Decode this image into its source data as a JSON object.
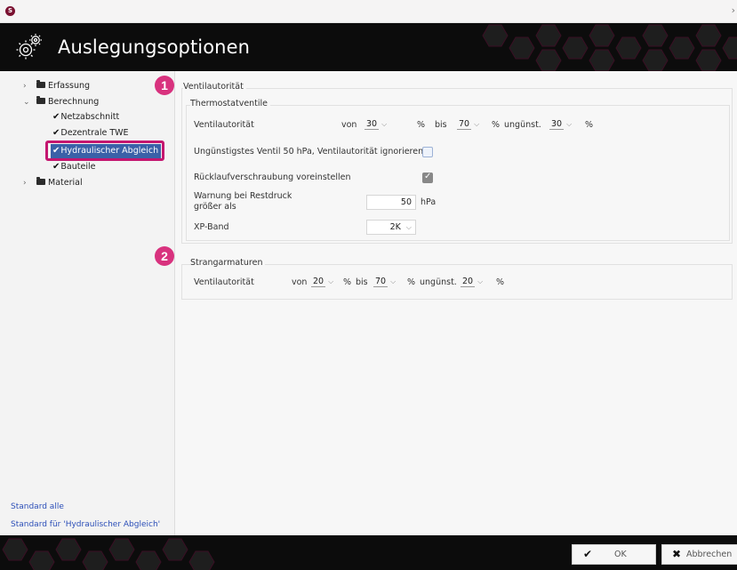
{
  "app": {
    "title": "Auslegungsoptionen",
    "logo_glyph": "S"
  },
  "tree": {
    "items": [
      {
        "label": "Erfassung",
        "chevron": "›",
        "type": "folder"
      },
      {
        "label": "Berechnung",
        "chevron": "⌄",
        "type": "folder"
      },
      {
        "label": "Netzabschnitt",
        "type": "check"
      },
      {
        "label": "Dezentrale TWE",
        "type": "check"
      },
      {
        "label": "Hydraulischer Abgleich",
        "type": "check",
        "selected": true
      },
      {
        "label": "Bauteile",
        "type": "check"
      },
      {
        "label": "Material",
        "chevron": "›",
        "type": "folder"
      }
    ]
  },
  "links": {
    "standard_all": "Standard alle",
    "standard_current": "Standard für 'Hydraulischer Abgleich'"
  },
  "badges": {
    "one": "1",
    "two": "2"
  },
  "ventilautoritaet": {
    "legend": "Ventilautorität",
    "thermo": {
      "legend": "Thermostatventile",
      "row_label": "Ventilautorität",
      "von_label": "von",
      "von_value": "30",
      "pct1": "%",
      "bis_label": "bis",
      "bis_value": "70",
      "pct2": "%",
      "unguenst_label": "ungünst.",
      "unguenst_value": "30",
      "pct3": "%",
      "ignore_label": "Ungünstigstes Ventil 50 hPa, Ventilautorität ignorieren",
      "ignore_checked": false,
      "ruecklauf_label": "Rücklaufverschraubung voreinstellen",
      "ruecklauf_checked": true,
      "warnung_label_1": "Warnung bei Restdruck",
      "warnung_label_2": "größer als",
      "warnung_value": "50",
      "warnung_unit": "hPa",
      "xp_label": "XP-Band",
      "xp_value": "2K"
    }
  },
  "strang": {
    "legend": "Strangarmaturen",
    "row_label": "Ventilautorität",
    "von_label": "von",
    "von_value": "20",
    "pct1": "%",
    "bis_label": "bis",
    "bis_value": "70",
    "pct2": "%",
    "unguenst_label": "ungünst.",
    "unguenst_value": "20",
    "pct3": "%"
  },
  "buttons": {
    "ok": "OK",
    "cancel": "Abbrechen"
  },
  "colors": {
    "brand": "#d8327e",
    "selection": "#3a61a8",
    "header_bg": "#0c0c0c",
    "link": "#2c4fb8"
  }
}
